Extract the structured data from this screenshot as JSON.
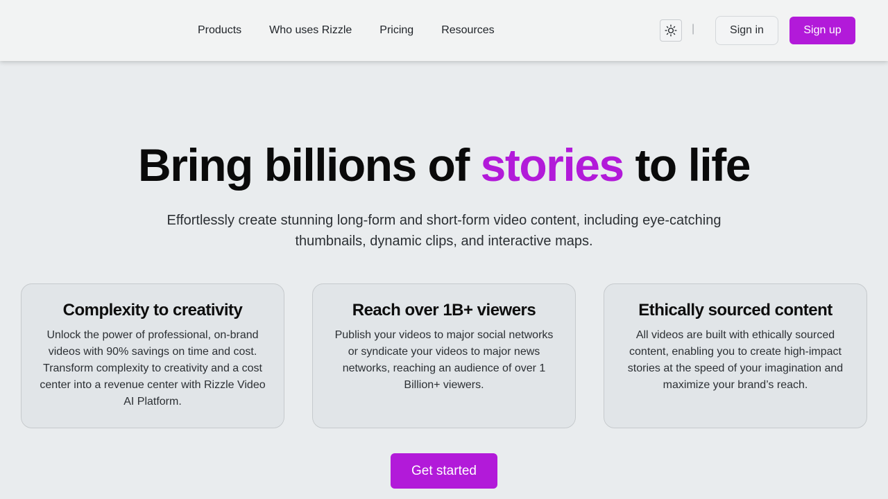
{
  "nav": {
    "items": [
      "Products",
      "Who uses Rizzle",
      "Pricing",
      "Resources"
    ]
  },
  "header": {
    "theme_icon": "sun-icon",
    "divider": "|",
    "sign_in": "Sign in",
    "sign_up": "Sign up"
  },
  "hero": {
    "title_before": "Bring billions of ",
    "title_accent": "stories",
    "title_after": " to life",
    "subtitle": "Effortlessly create stunning long-form and short-form video content, including eye-catching thumbnails, dynamic clips, and interactive maps."
  },
  "features": [
    {
      "title": "Complexity to creativity",
      "body": "Unlock the power of professional, on-brand videos with 90% savings on time and cost. Transform complexity to creativity and a cost center into a revenue center with Rizzle Video AI Platform."
    },
    {
      "title": "Reach over 1B+ viewers",
      "body": "Publish your videos to major social networks or syndicate your videos to major news networks, reaching an audience of over 1 Billion+ viewers."
    },
    {
      "title": "Ethically sourced content",
      "body": "All videos are built with ethically sourced content, enabling you to create high-impact stories at the speed of your imagination and maximize your brand’s reach."
    }
  ],
  "cta": {
    "label": "Get started"
  },
  "colors": {
    "accent": "#b21ad9",
    "background": "#e9ecee",
    "header_bg": "#f2f3f3",
    "card_bg": "#e1e5e8"
  }
}
